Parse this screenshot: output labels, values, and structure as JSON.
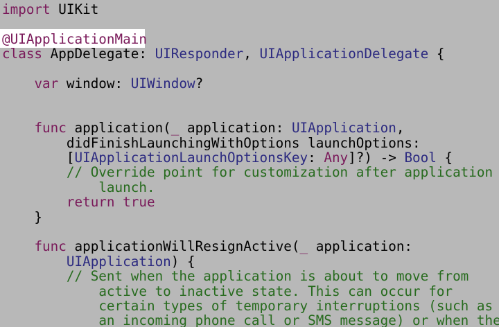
{
  "colors": {
    "background": "#b8b8b8",
    "plain": "#000000",
    "keyword": "#7a1a5a",
    "type": "#2c2a80",
    "comment": "#276b1e",
    "highlight": "#ffffff"
  },
  "lines": [
    [
      {
        "t": "import",
        "c": "keyword"
      },
      {
        "t": " UIKit",
        "c": "plain"
      }
    ],
    [],
    [
      {
        "t": "@UIApplicationMain",
        "c": "keyword"
      }
    ],
    [
      {
        "t": "class",
        "c": "keyword"
      },
      {
        "t": " AppDelegate: ",
        "c": "plain"
      },
      {
        "t": "UIResponder",
        "c": "type"
      },
      {
        "t": ", ",
        "c": "plain"
      },
      {
        "t": "UIApplicationDelegate",
        "c": "type"
      },
      {
        "t": " {",
        "c": "plain"
      }
    ],
    [],
    [
      {
        "t": "    ",
        "c": "plain"
      },
      {
        "t": "var",
        "c": "keyword"
      },
      {
        "t": " window: ",
        "c": "plain"
      },
      {
        "t": "UIWindow",
        "c": "type"
      },
      {
        "t": "?",
        "c": "plain"
      }
    ],
    [],
    [],
    [
      {
        "t": "    ",
        "c": "plain"
      },
      {
        "t": "func",
        "c": "keyword"
      },
      {
        "t": " application(",
        "c": "plain"
      },
      {
        "t": "_",
        "c": "keyword"
      },
      {
        "t": " application: ",
        "c": "plain"
      },
      {
        "t": "UIApplication",
        "c": "type"
      },
      {
        "t": ",",
        "c": "plain"
      }
    ],
    [
      {
        "t": "        didFinishLaunchingWithOptions launchOptions:",
        "c": "plain"
      }
    ],
    [
      {
        "t": "        [",
        "c": "plain"
      },
      {
        "t": "UIApplicationLaunchOptionsKey",
        "c": "type"
      },
      {
        "t": ": ",
        "c": "plain"
      },
      {
        "t": "Any",
        "c": "keyword"
      },
      {
        "t": "]?) -> ",
        "c": "plain"
      },
      {
        "t": "Bool",
        "c": "type"
      },
      {
        "t": " {",
        "c": "plain"
      }
    ],
    [
      {
        "t": "        ",
        "c": "plain"
      },
      {
        "t": "// Override point for customization after application",
        "c": "comment"
      }
    ],
    [
      {
        "t": "            ",
        "c": "plain"
      },
      {
        "t": "launch.",
        "c": "comment"
      }
    ],
    [
      {
        "t": "        ",
        "c": "plain"
      },
      {
        "t": "return",
        "c": "keyword"
      },
      {
        "t": " ",
        "c": "plain"
      },
      {
        "t": "true",
        "c": "keyword"
      }
    ],
    [
      {
        "t": "    }",
        "c": "plain"
      }
    ],
    [],
    [
      {
        "t": "    ",
        "c": "plain"
      },
      {
        "t": "func",
        "c": "keyword"
      },
      {
        "t": " applicationWillResignActive(",
        "c": "plain"
      },
      {
        "t": "_",
        "c": "keyword"
      },
      {
        "t": " application:",
        "c": "plain"
      }
    ],
    [
      {
        "t": "        ",
        "c": "plain"
      },
      {
        "t": "UIApplication",
        "c": "type"
      },
      {
        "t": ") {",
        "c": "plain"
      }
    ],
    [
      {
        "t": "        ",
        "c": "plain"
      },
      {
        "t": "// Sent when the application is about to move from",
        "c": "comment"
      }
    ],
    [
      {
        "t": "            ",
        "c": "plain"
      },
      {
        "t": "active to inactive state. This can occur for",
        "c": "comment"
      }
    ],
    [
      {
        "t": "            ",
        "c": "plain"
      },
      {
        "t": "certain types of temporary interruptions (such as",
        "c": "comment"
      }
    ],
    [
      {
        "t": "            ",
        "c": "plain"
      },
      {
        "t": "an incoming phone call or SMS message) or when the",
        "c": "comment"
      }
    ]
  ]
}
